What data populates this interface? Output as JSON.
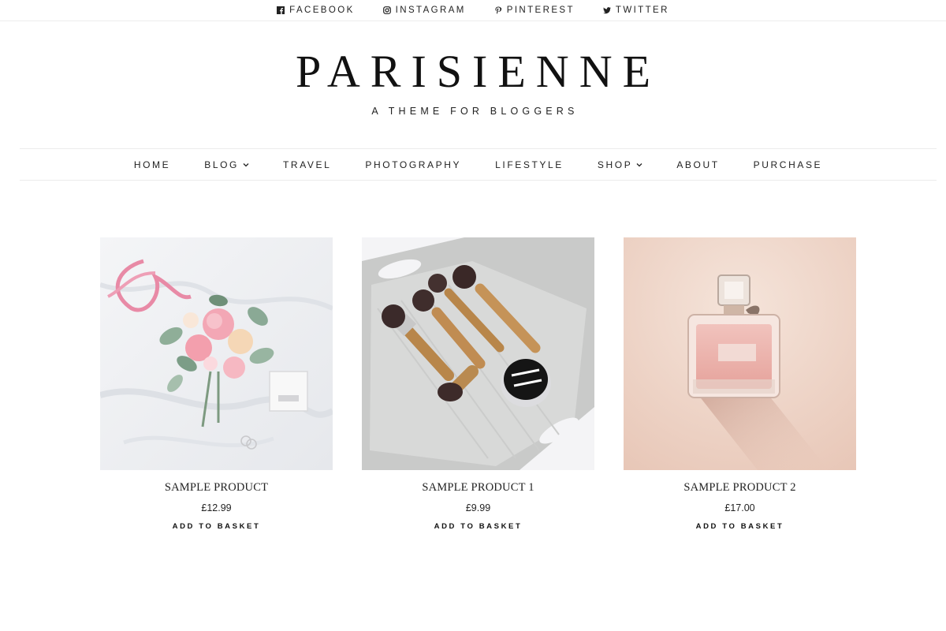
{
  "social": [
    {
      "label": "FACEBOOK",
      "icon": "facebook-icon"
    },
    {
      "label": "INSTAGRAM",
      "icon": "instagram-icon"
    },
    {
      "label": "PINTEREST",
      "icon": "pinterest-icon"
    },
    {
      "label": "TWITTER",
      "icon": "twitter-icon"
    }
  ],
  "site": {
    "title": "PARISIENNE",
    "tagline": "A THEME FOR BLOGGERS"
  },
  "nav": [
    {
      "label": "HOME",
      "has_dropdown": false
    },
    {
      "label": "BLOG",
      "has_dropdown": true
    },
    {
      "label": "TRAVEL",
      "has_dropdown": false
    },
    {
      "label": "PHOTOGRAPHY",
      "has_dropdown": false
    },
    {
      "label": "LIFESTYLE",
      "has_dropdown": false
    },
    {
      "label": "SHOP",
      "has_dropdown": true
    },
    {
      "label": "ABOUT",
      "has_dropdown": false
    },
    {
      "label": "PURCHASE",
      "has_dropdown": false
    }
  ],
  "products": [
    {
      "title": "SAMPLE PRODUCT",
      "price": "£12.99",
      "button": "ADD TO BASKET",
      "image": "flower-bouquet-photo"
    },
    {
      "title": "SAMPLE PRODUCT 1",
      "price": "£9.99",
      "button": "ADD TO BASKET",
      "image": "makeup-brushes-photo"
    },
    {
      "title": "SAMPLE PRODUCT 2",
      "price": "£17.00",
      "button": "ADD TO BASKET",
      "image": "perfume-bottle-photo"
    }
  ],
  "colors": {
    "text": "#222222",
    "divider": "#ececec",
    "background": "#ffffff"
  }
}
